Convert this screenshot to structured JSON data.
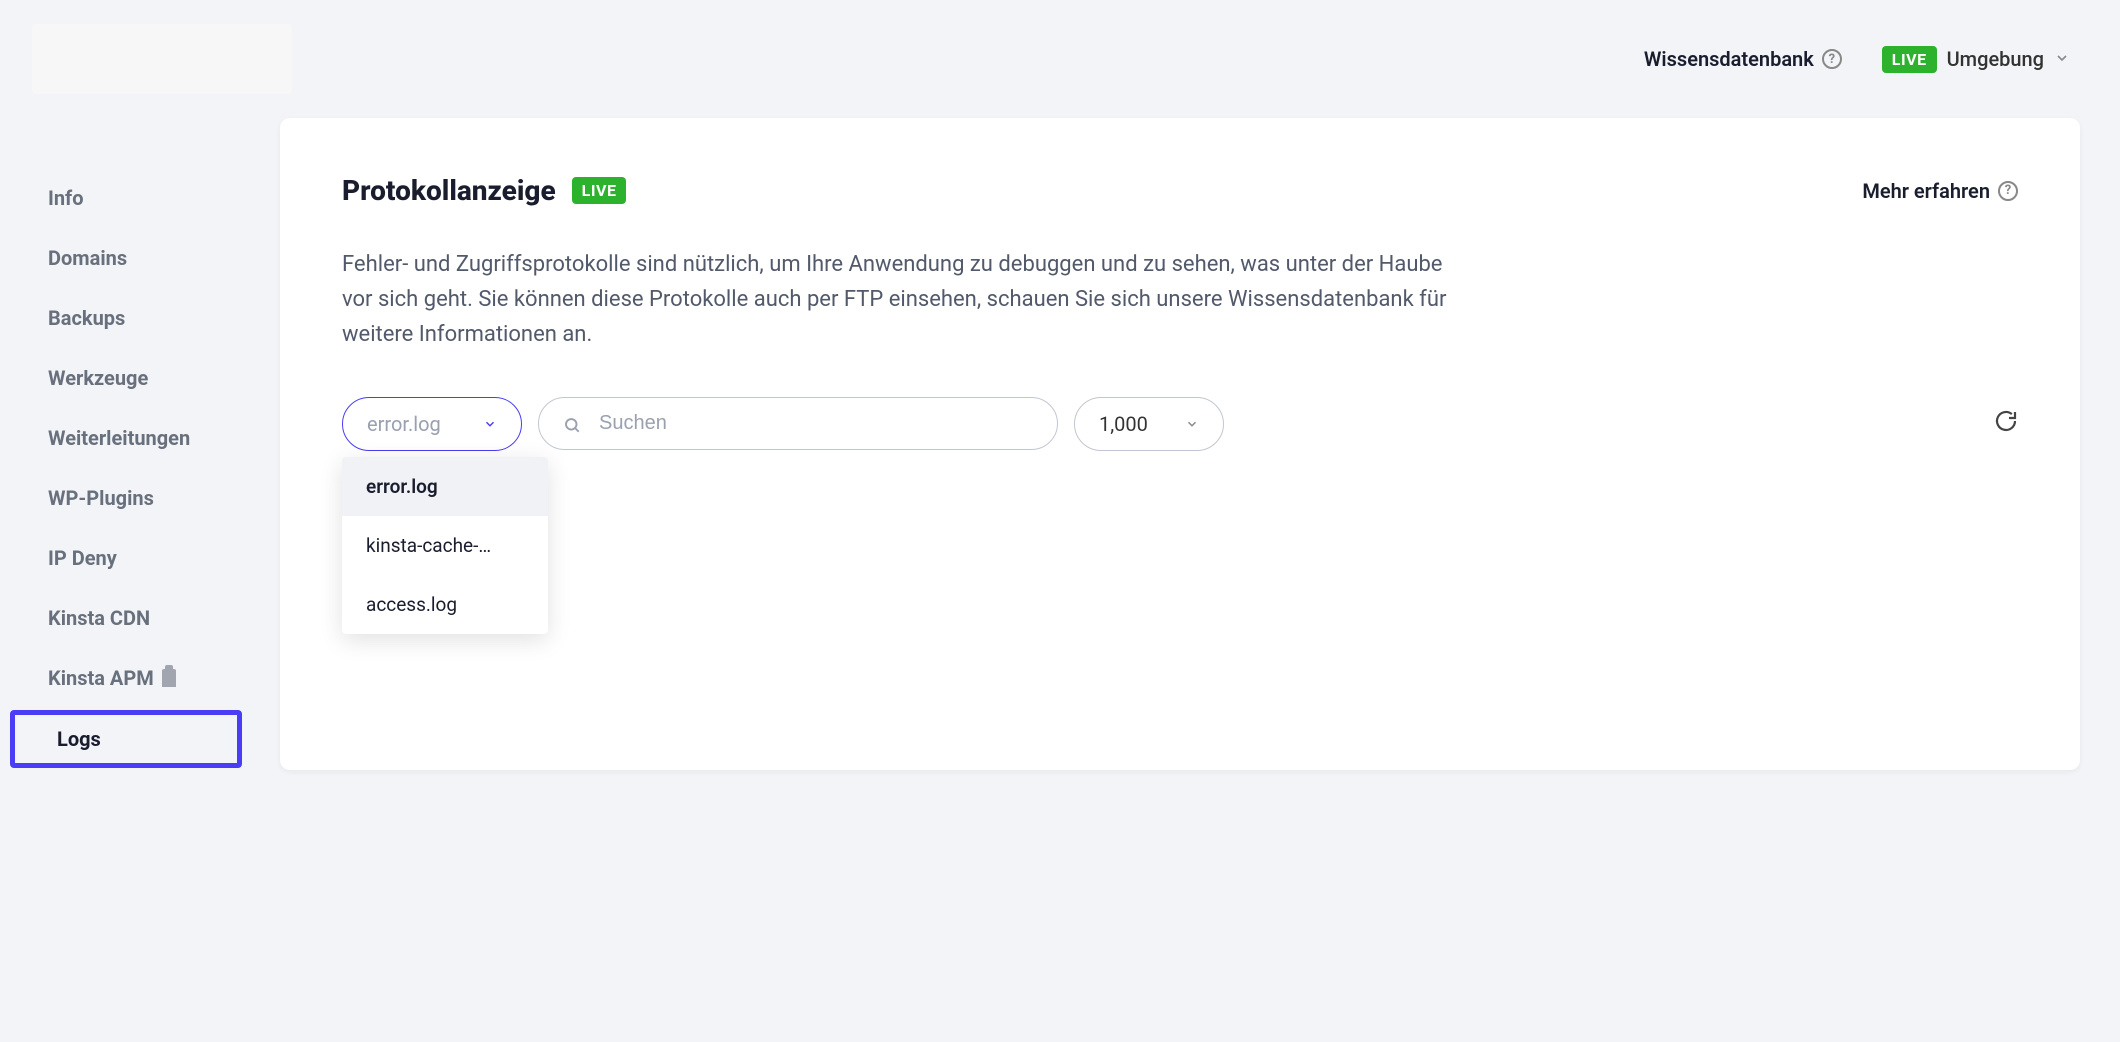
{
  "topbar": {
    "knowledge_base_label": "Wissensdatenbank",
    "env_badge": "LIVE",
    "env_label": "Umgebung"
  },
  "sidebar": {
    "items": [
      {
        "label": "Info"
      },
      {
        "label": "Domains"
      },
      {
        "label": "Backups"
      },
      {
        "label": "Werkzeuge"
      },
      {
        "label": "Weiterleitungen"
      },
      {
        "label": "WP-Plugins"
      },
      {
        "label": "IP Deny"
      },
      {
        "label": "Kinsta CDN"
      },
      {
        "label": "Kinsta APM",
        "beta": true
      },
      {
        "label": "Logs",
        "active": true
      }
    ]
  },
  "main": {
    "title": "Protokollanzeige",
    "title_badge": "LIVE",
    "learn_more": "Mehr erfahren",
    "description": "Fehler- und Zugriffsprotokolle sind nützlich, um Ihre Anwendung zu debuggen und zu sehen, was unter der Haube vor sich geht. Sie können diese Protokolle auch per FTP einsehen, schauen Sie sich unsere Wissensdatenbank für weitere Informationen an."
  },
  "controls": {
    "log_select_value": "error.log",
    "search_placeholder": "Suchen",
    "count_value": "1,000",
    "dropdown_options": [
      {
        "label": "error.log",
        "selected": true
      },
      {
        "label": "kinsta-cache-…"
      },
      {
        "label": "access.log"
      }
    ]
  }
}
